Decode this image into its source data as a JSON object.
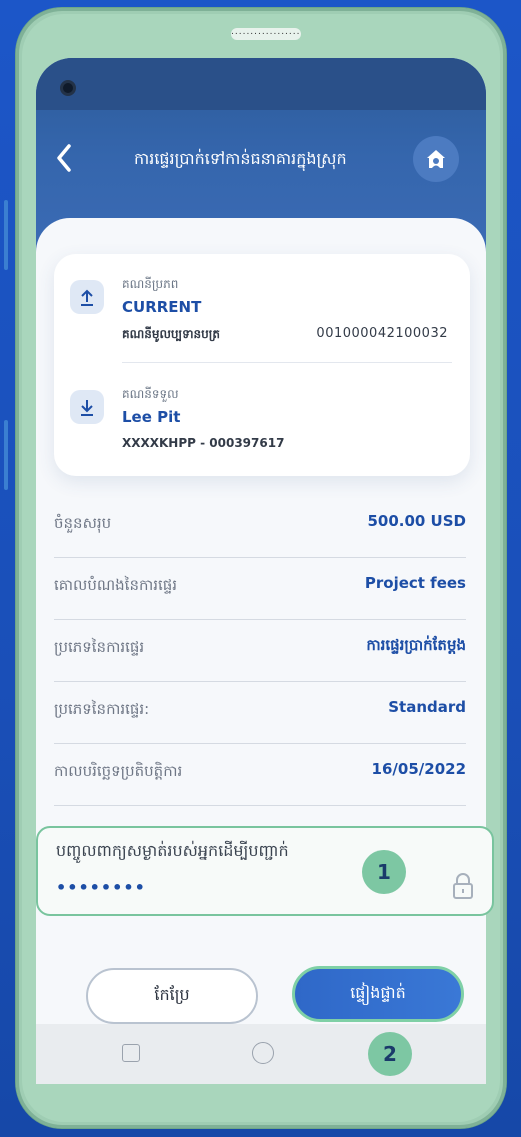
{
  "device": {
    "speaker_text": "..................."
  },
  "header": {
    "title": "ការផ្ទេរប្រាក់ទៅកាន់ធនាគារក្នុងស្រុក",
    "back_glyph": "‹"
  },
  "from_account": {
    "label": "គណនីប្រភព",
    "name": "CURRENT",
    "type": "គណនីមូលប្បទានបត្រ",
    "number": "001000042100032",
    "icon": "upload-icon"
  },
  "to_account": {
    "label": "គណនីទទួល",
    "name": "Lee Pit",
    "number": "XXXXKHPP - 000397617",
    "icon": "download-icon"
  },
  "details": [
    {
      "label": "ចំនួនសរុប",
      "value": "500.00 USD"
    },
    {
      "label": "គោលបំណងនៃការផ្ទេរ",
      "value": "Project fees"
    },
    {
      "label": "ប្រភេទនៃការផ្ទេរ",
      "value": "ការផ្ទេរប្រាក់តែម្តង"
    },
    {
      "label": "ប្រភេទនៃការផ្ទេរ:",
      "value": "Standard"
    },
    {
      "label": "កាលបរិច្ឆេទប្រតិបត្តិការ",
      "value": "16/05/2022"
    }
  ],
  "password": {
    "placeholder": "បញ្ចូលពាក្យសម្ងាត់របស់អ្នកដើម្បីបញ្ជាក់",
    "value": "••••••••"
  },
  "buttons": {
    "edit": "កែប្រែ",
    "confirm": "ផ្ទៀងផ្ទាត់"
  },
  "markers": [
    "1",
    "2"
  ],
  "colors": {
    "accent_blue": "#1d4ea6",
    "header_blue": "#3566ad",
    "highlight_green": "#7dc7a3"
  }
}
